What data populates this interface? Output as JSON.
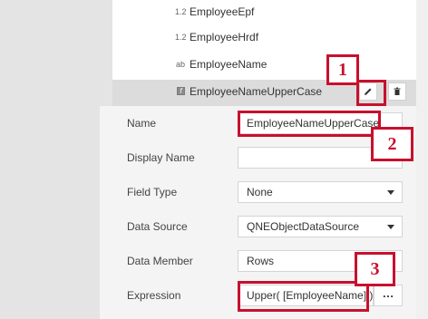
{
  "fields": [
    {
      "type_glyph": "1.2",
      "name": "EmployeeEpf"
    },
    {
      "type_glyph": "1.2",
      "name": "EmployeeHrdf"
    },
    {
      "type_glyph": "ab",
      "name": "EmployeeName"
    },
    {
      "type_glyph": "f",
      "name": "EmployeeNameUpperCase",
      "selected": true
    }
  ],
  "row_actions": {
    "edit_icon": "pencil-icon",
    "delete_icon": "trash-icon"
  },
  "form": {
    "name_label": "Name",
    "name_value": "EmployeeNameUpperCase",
    "display_name_label": "Display Name",
    "display_name_value": "",
    "field_type_label": "Field Type",
    "field_type_value": "None",
    "data_source_label": "Data Source",
    "data_source_value": "QNEObjectDataSource",
    "data_member_label": "Data Member",
    "data_member_value": "Rows",
    "expression_label": "Expression",
    "expression_value": "Upper( [EmployeeName] )",
    "expression_button": "…"
  },
  "callouts": [
    "1",
    "2",
    "3"
  ],
  "colors": {
    "highlight": "#c8102e",
    "selected_row": "#dcdcdc"
  }
}
